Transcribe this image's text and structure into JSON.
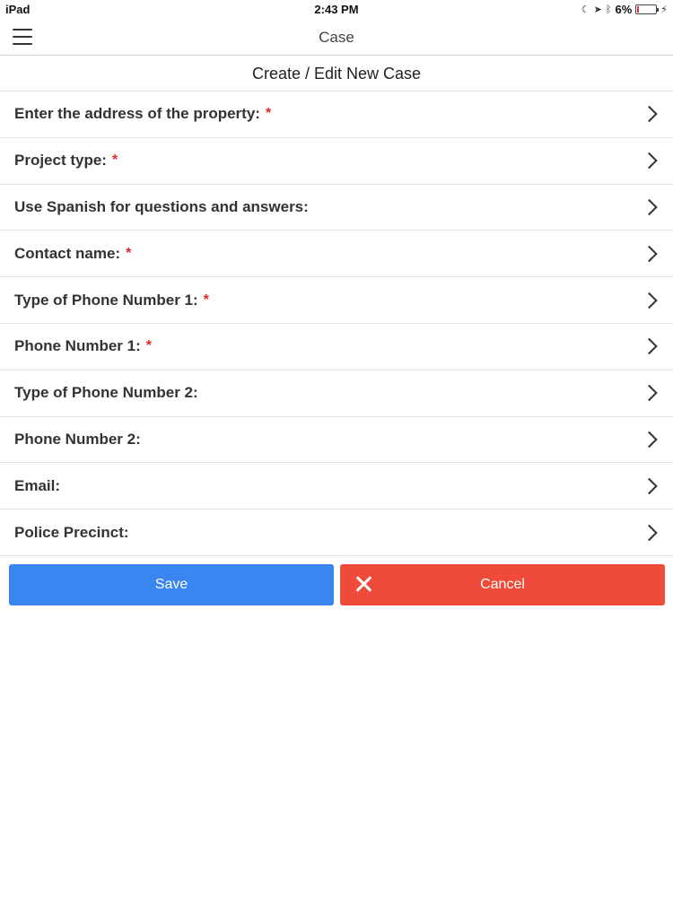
{
  "status_bar": {
    "carrier": "iPad",
    "time": "2:43 PM",
    "battery": "6%"
  },
  "nav": {
    "title": "Case"
  },
  "form": {
    "title": "Create / Edit New Case",
    "fields": [
      {
        "label": "Enter the address of the property:",
        "required": true
      },
      {
        "label": "Project type:",
        "required": true
      },
      {
        "label": "Use Spanish for questions and answers:",
        "required": false
      },
      {
        "label": "Contact name:",
        "required": true
      },
      {
        "label": "Type of Phone Number 1:",
        "required": true
      },
      {
        "label": "Phone Number 1:",
        "required": true
      },
      {
        "label": "Type of Phone Number 2:",
        "required": false
      },
      {
        "label": "Phone Number 2:",
        "required": false
      },
      {
        "label": "Email:",
        "required": false
      },
      {
        "label": "Police Precinct:",
        "required": false
      }
    ],
    "required_marker": "*"
  },
  "buttons": {
    "save_label": "Save",
    "cancel_label": "Cancel"
  },
  "colors": {
    "save": "#3a86f0",
    "cancel": "#ef4a3a",
    "required": "#e0262a"
  }
}
